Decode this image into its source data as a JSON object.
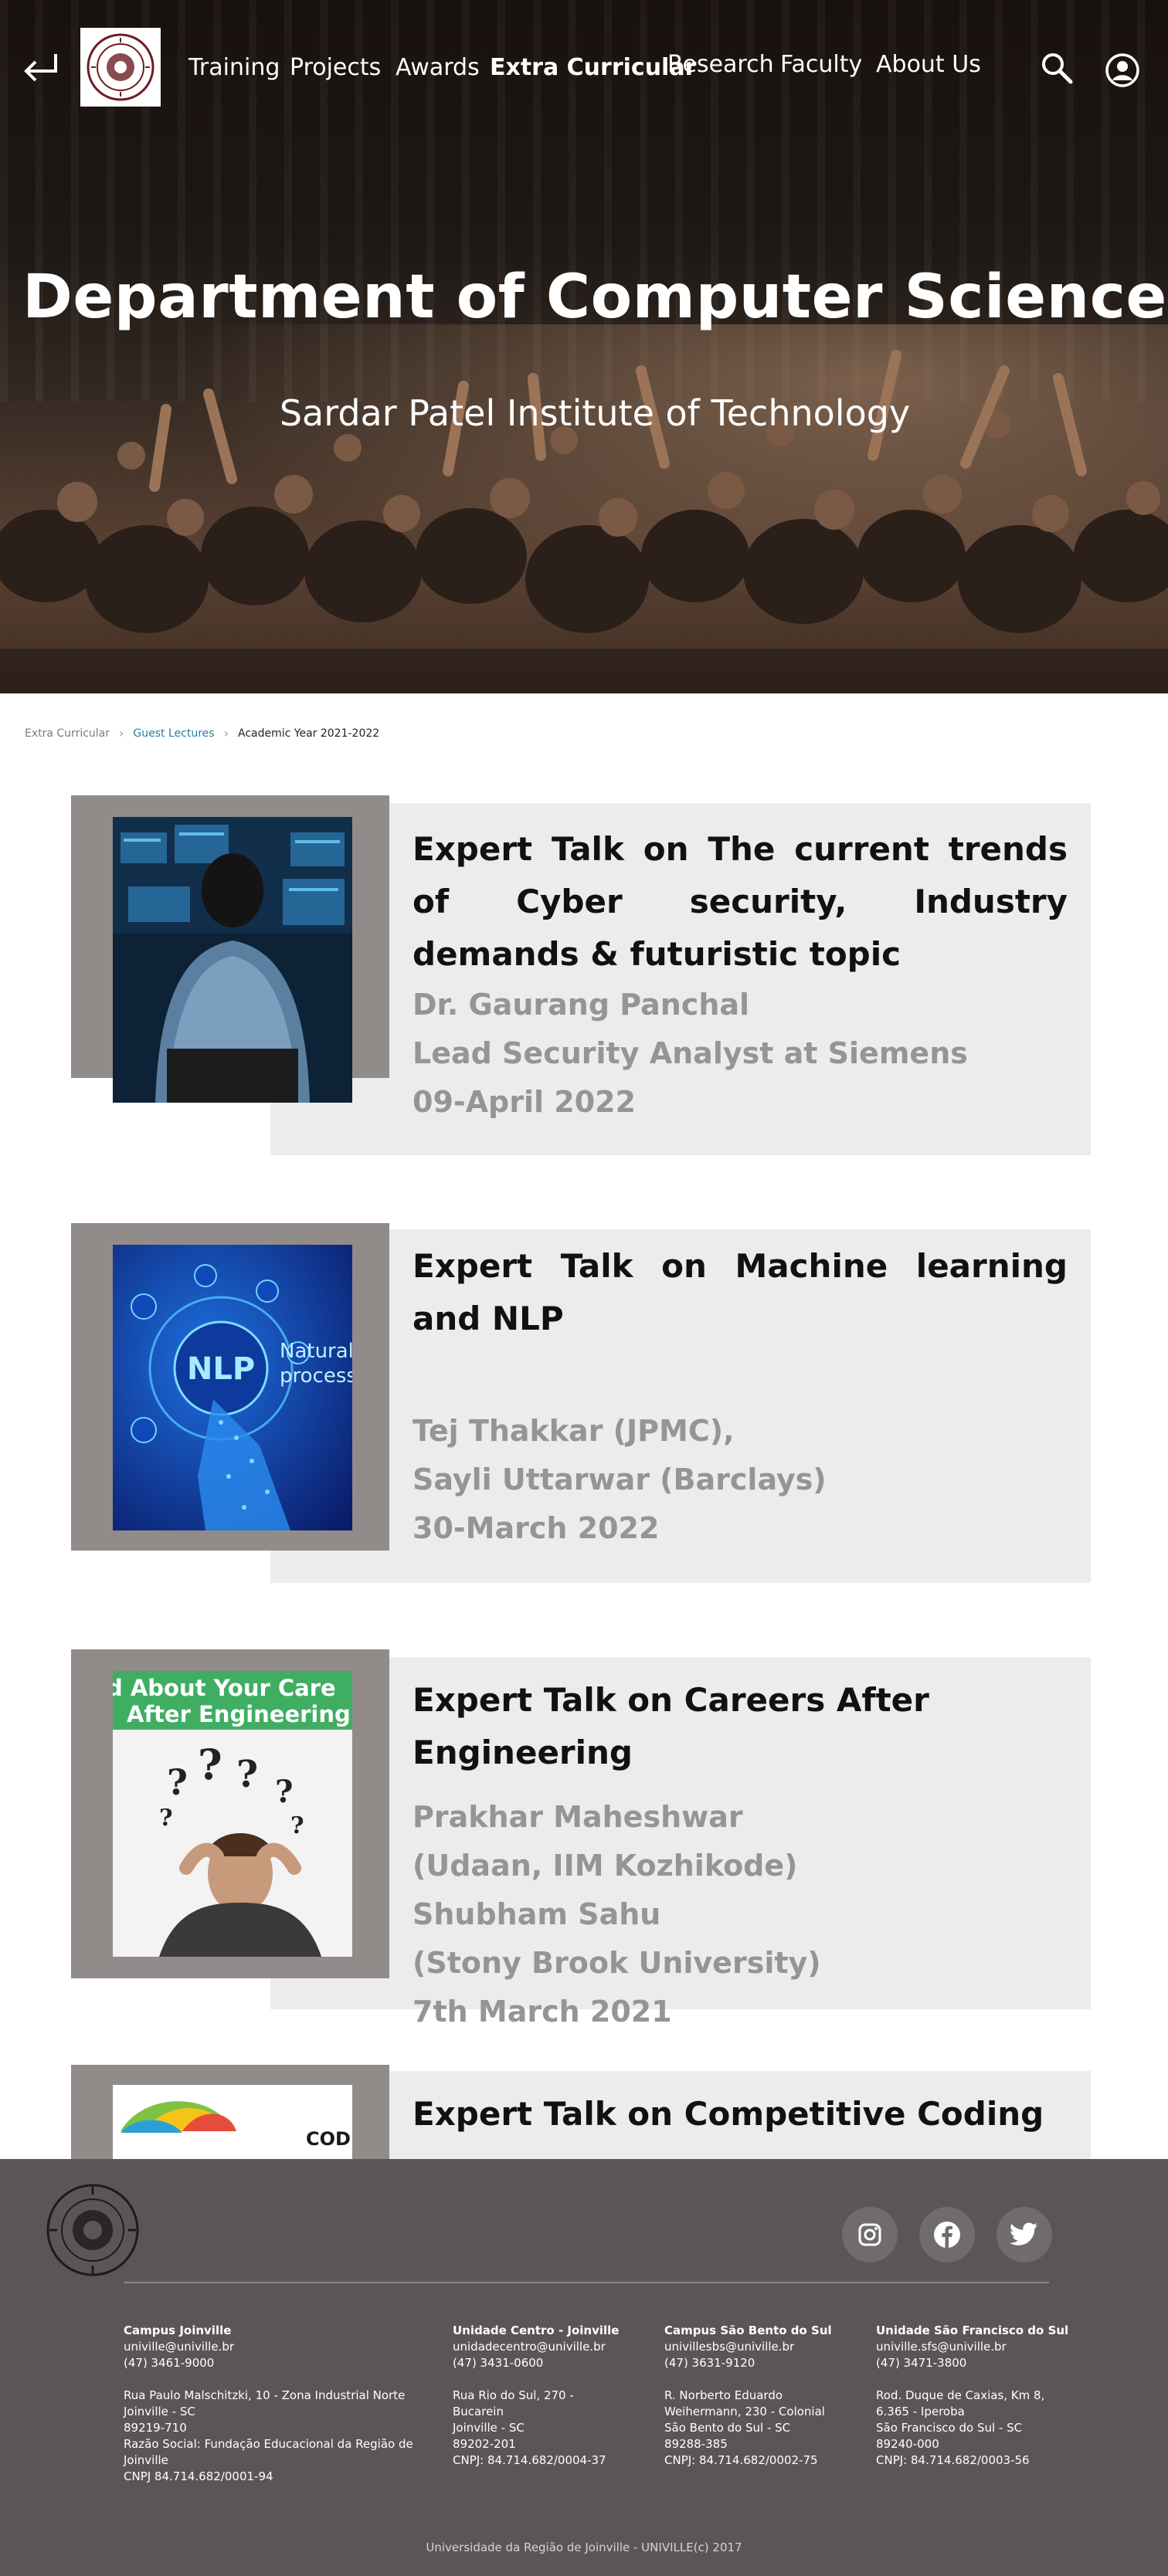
{
  "nav": {
    "links": [
      "Training",
      "Projects",
      "Awards",
      "Extra Curricular",
      "Research",
      "Faculty",
      "About Us"
    ],
    "active": "Extra Curricular"
  },
  "hero": {
    "title": "Department of Computer Science",
    "subtitle": "Sardar Patel Institute of Technology"
  },
  "breadcrumb": {
    "items": [
      "Extra Curricular",
      "Guest Lectures",
      "Academic Year 2021-2022"
    ]
  },
  "talks": [
    {
      "title": "Expert Talk on The current trends of Cyber security, Industry demands & futuristic topic",
      "lines": [
        "Dr. Gaurang Panchal",
        "Lead Security Analyst at Siemens",
        "09-April 2022"
      ]
    },
    {
      "title": "Expert Talk on Machine learning and NLP",
      "lines": [
        "Tej Thakkar (JPMC),",
        "Sayli Uttarwar  (Barclays)",
        "30-March 2022"
      ],
      "image_text": [
        "NLP",
        "Natural",
        "process"
      ]
    },
    {
      "title": "Expert Talk on Careers After Engineering",
      "lines": [
        "Prakhar Maheshwar",
        "(Udaan, IIM Kozhikode)",
        "Shubham Sahu",
        "(Stony Brook University)",
        "7th March 2021"
      ],
      "image_text": [
        "d About Your Care",
        "After Engineering"
      ]
    },
    {
      "title": "Expert Talk on Competitive Coding",
      "lines": [],
      "image_text": [
        "CODE"
      ]
    }
  ],
  "footer": {
    "columns": [
      {
        "heading": "Campus Joinville",
        "contact": [
          "univille@univille.br",
          "(47) 3461-9000"
        ],
        "address": [
          "Rua Paulo Malschitzki, 10 - Zona Industrial Norte",
          "Joinville - SC",
          "89219-710",
          "Razão Social: Fundação Educacional da Região de",
          "Joinville",
          "CNPJ 84.714.682/0001-94"
        ]
      },
      {
        "heading": "Unidade Centro - Joinville",
        "contact": [
          "unidadecentro@univille.br",
          "(47) 3431-0600"
        ],
        "address": [
          "Rua Rio do Sul, 270 -",
          "Bucarein",
          "Joinville - SC",
          "89202-201",
          "CNPJ: 84.714.682/0004-37"
        ]
      },
      {
        "heading": "Campus São Bento do Sul",
        "contact": [
          "univillesbs@univille.br",
          "(47) 3631-9120"
        ],
        "address": [
          "R. Norberto Eduardo",
          "Weihermann, 230 - Colonial",
          "São Bento do Sul - SC",
          "89288-385",
          "CNPJ: 84.714.682/0002-75"
        ]
      },
      {
        "heading": "Unidade São Francisco do Sul",
        "contact": [
          "univille.sfs@univille.br",
          "(47) 3471-3800"
        ],
        "address": [
          "Rod. Duque de Caxias, Km 8,",
          "6.365 - Iperoba",
          "São Francisco do Sul - SC",
          "89240-000",
          "CNPJ: 84.714.682/0003-56"
        ]
      }
    ],
    "copyright": "Universidade da Região de Joinville - UNIVILLE(c) 2017",
    "social": [
      "instagram-icon",
      "facebook-icon",
      "twitter-icon"
    ]
  },
  "colors": {
    "card_bg": "#ececec",
    "card_frame": "#918b8a",
    "detail_text": "#959595",
    "footer_bg": "#5b5656",
    "crumb_link": "#2a7da8"
  }
}
